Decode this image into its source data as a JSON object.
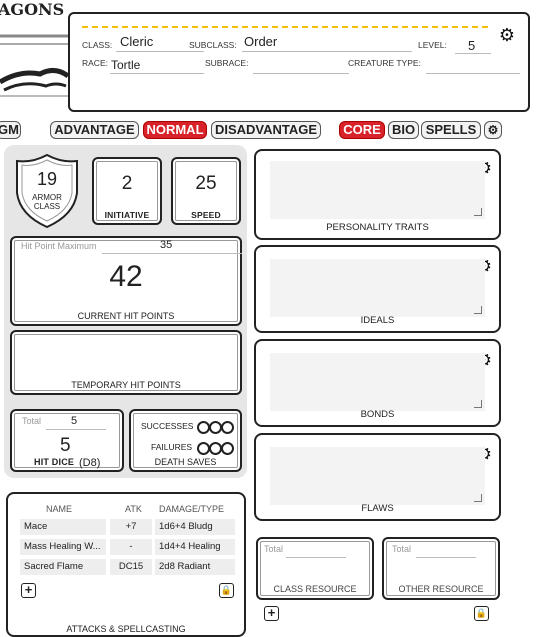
{
  "header": {
    "logo_text": "AGONS",
    "class_label": "CLASS:",
    "class_value": "Cleric",
    "subclass_label": "SUBCLASS:",
    "subclass_value": "Order",
    "level_label": "LEVEL:",
    "level_value": "5",
    "race_label": "RACE:",
    "race_value": "Tortle",
    "subrace_label": "SUBRACE:",
    "subrace_value": "",
    "creature_type_label": "CREATURE TYPE:",
    "creature_type_value": ""
  },
  "toolbar": {
    "gm_label": "GM",
    "advantage_label": "ADVANTAGE",
    "normal_label": "NORMAL",
    "disadvantage_label": "DISADVANTAGE",
    "core_label": "CORE",
    "bio_label": "BIO",
    "spells_label": "SPELLS",
    "active_roll_mode": "NORMAL",
    "active_tab": "CORE",
    "accent_color": "#d8232a"
  },
  "combat": {
    "armor_class": {
      "value": "19",
      "label_1": "ARMOR",
      "label_2": "CLASS"
    },
    "initiative": {
      "value": "2",
      "label": "INITIATIVE"
    },
    "speed": {
      "value": "25",
      "label": "SPEED"
    },
    "hp_max_label": "Hit Point Maximum",
    "hp_max_value": "35",
    "current_hp_value": "42",
    "current_hp_label": "CURRENT HIT POINTS",
    "temp_hp_label": "TEMPORARY HIT POINTS",
    "hit_dice": {
      "total_label": "Total",
      "total_value": "5",
      "value": "5",
      "label": "HIT DICE",
      "die": "(D8)"
    },
    "death_saves": {
      "successes_label": "SUCCESSES",
      "failures_label": "FAILURES",
      "label": "DEATH SAVES"
    }
  },
  "attacks": {
    "headers": {
      "name": "NAME",
      "atk": "ATK",
      "damage": "DAMAGE/TYPE"
    },
    "rows": [
      {
        "name": "Mace",
        "atk": "+7",
        "damage": "1d6+4 Bludg"
      },
      {
        "name": "Mass Healing W...",
        "atk": "-",
        "damage": "1d4+4 Healing"
      },
      {
        "name": "Sacred Flame",
        "atk": "DC15",
        "damage": "2d8 Radiant"
      }
    ],
    "footer_label": "ATTACKS & SPELLCASTING",
    "add_icon": "plus-icon",
    "lock_icon": "lock-icon"
  },
  "traits": {
    "personality_label": "PERSONALITY TRAITS",
    "ideals_label": "IDEALS",
    "bonds_label": "BONDS",
    "flaws_label": "FLAWS",
    "gear_icon": "gear-icon"
  },
  "resources": {
    "class_total_label": "Total",
    "class_label": "CLASS RESOURCE",
    "other_total_label": "Total",
    "other_label": "OTHER RESOURCE"
  }
}
